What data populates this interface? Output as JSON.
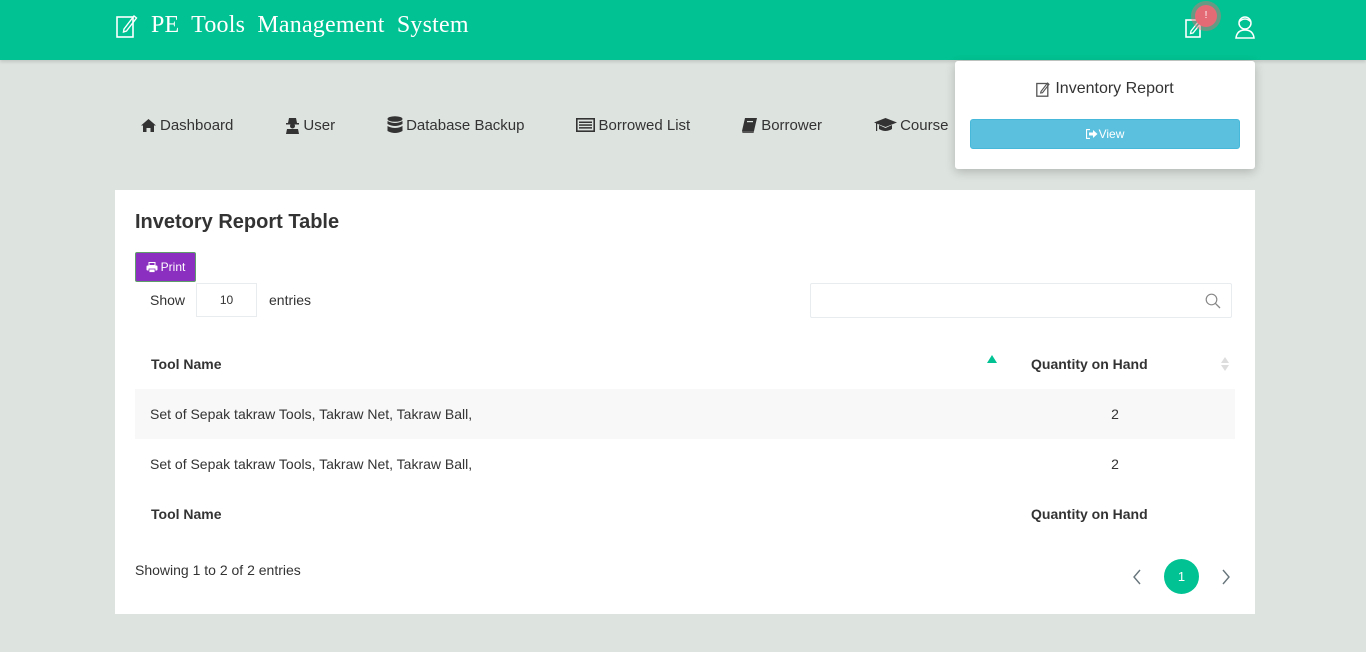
{
  "header": {
    "title": "PE Tools Management System",
    "notification_badge": "!",
    "icons": {
      "brand": "edit-icon",
      "notifications": "edit-icon",
      "user": "user-avatar-icon"
    }
  },
  "nav": {
    "items": [
      {
        "label": "Dashboard",
        "icon": "home-icon"
      },
      {
        "label": "User",
        "icon": "user-secret-icon"
      },
      {
        "label": "Database Backup",
        "icon": "database-icon"
      },
      {
        "label": "Borrowed List",
        "icon": "list-alt-icon"
      },
      {
        "label": "Borrower",
        "icon": "book-icon"
      },
      {
        "label": "Course",
        "icon": "graduation-cap-icon"
      }
    ]
  },
  "dropdown": {
    "title": "Inventory Report",
    "view_label": "View"
  },
  "card": {
    "title": "Invetory Report Table",
    "print_label": "Print",
    "show_label": "Show",
    "entries_value": "10",
    "entries_label": "entries",
    "search_value": "",
    "table": {
      "columns": [
        "Tool Name",
        "Quantity on Hand"
      ],
      "rows": [
        {
          "tool_name": "Set of Sepak takraw Tools, Takraw Net, Takraw Ball,",
          "quantity": "2"
        },
        {
          "tool_name": "Set of Sepak takraw Tools, Takraw Net, Takraw Ball,",
          "quantity": "2"
        }
      ],
      "footer_columns": [
        "Tool Name",
        "Quantity on Hand"
      ],
      "sort": {
        "column": "Tool Name",
        "direction": "ascending"
      }
    },
    "info": "Showing 1 to 2 of 2 entries",
    "pagination": {
      "current_page": "1"
    }
  },
  "colors": {
    "primary": "#00c292",
    "badge": "#e46a76",
    "info_button": "#5bc0de",
    "print_button": "#8a2fbf",
    "background": "#dde3df"
  }
}
